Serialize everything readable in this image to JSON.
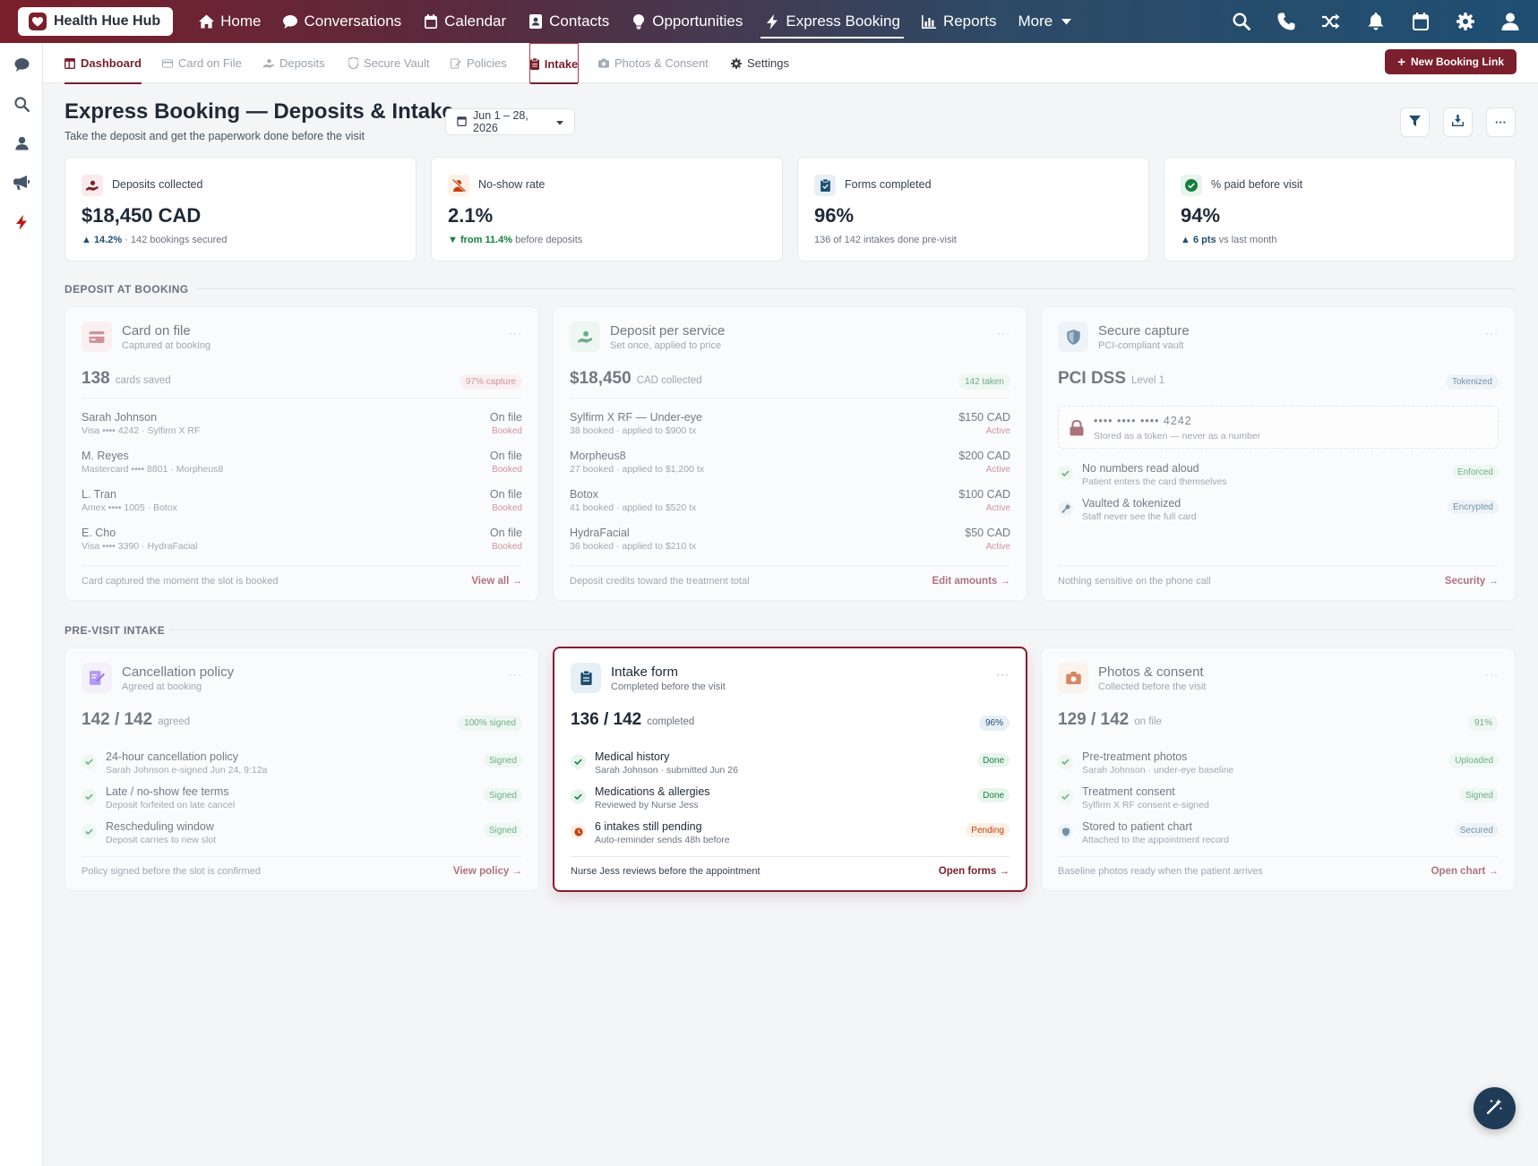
{
  "brand": {
    "name": "Health Hue Hub"
  },
  "nav": {
    "items": [
      {
        "label": "Home",
        "icon": "home-icon"
      },
      {
        "label": "Conversations",
        "icon": "chat-icon"
      },
      {
        "label": "Calendar",
        "icon": "calendar-icon"
      },
      {
        "label": "Contacts",
        "icon": "contact-card-icon"
      },
      {
        "label": "Opportunities",
        "icon": "lightbulb-icon"
      },
      {
        "label": "Express Booking",
        "icon": "bolt-icon",
        "active": true
      },
      {
        "label": "Reports",
        "icon": "bar-chart-icon"
      },
      {
        "label": "More",
        "icon": "caret-down-icon"
      }
    ],
    "right_icons": [
      "search-icon",
      "phone-icon",
      "shuffle-icon",
      "bell-icon",
      "calendar-icon",
      "gear-icon",
      "user-icon"
    ]
  },
  "rail_icons": [
    "chat-icon",
    "search-icon",
    "user-icon",
    "megaphone-icon",
    "bolt-icon"
  ],
  "subnav": {
    "tabs": [
      {
        "label": "Dashboard",
        "icon": "dashboard-icon",
        "active": true
      },
      {
        "label": "Card on File",
        "icon": "card-icon"
      },
      {
        "label": "Deposits",
        "icon": "hand-coin-icon"
      },
      {
        "label": "Secure Vault",
        "icon": "shield-icon"
      },
      {
        "label": "Policies",
        "icon": "sign-icon"
      },
      {
        "label": "Intake",
        "icon": "clipboard-icon"
      },
      {
        "label": "Photos & Consent",
        "icon": "camera-icon"
      },
      {
        "label": "Settings",
        "icon": "gear-icon"
      }
    ],
    "new_button": "New Booking Link"
  },
  "header": {
    "title": "Express Booking — Deposits & Intake",
    "subtitle": "Take the deposit and get the paperwork done before the visit",
    "date_range": "Jun 1 – 28, 2026"
  },
  "kpis": [
    {
      "label": "Deposits collected",
      "value": "$18,450 CAD",
      "delta": "▲ 14.2%",
      "note": " · 142 bookings secured",
      "color": "#7a1f2b"
    },
    {
      "label": "No-show rate",
      "value": "2.1%",
      "delta": "▼ from 11.4%",
      "note": " before deposits",
      "color": "#c2410c"
    },
    {
      "label": "Forms completed",
      "value": "96%",
      "delta": "",
      "note": "136 of 142 intakes done pre-visit",
      "color": "#1e4f73"
    },
    {
      "label": "% paid before visit",
      "value": "94%",
      "delta": "▲ 6 pts",
      "note": " vs last month",
      "color": "#15803d"
    }
  ],
  "sections": {
    "deposit": "DEPOSIT AT BOOKING",
    "intake": "PRE-VISIT INTAKE"
  },
  "card_on_file": {
    "title": "Card on file",
    "subtitle": "Captured at booking",
    "big": "138",
    "unit": "cards saved",
    "pill": "97% capture",
    "rows": [
      {
        "name": "Sarah Johnson",
        "sub": "Visa •••• 4242 · Sylfirm X RF",
        "value": "On file",
        "tag": "Booked"
      },
      {
        "name": "M. Reyes",
        "sub": "Mastercard •••• 8801 · Morpheus8",
        "value": "On file",
        "tag": "Booked"
      },
      {
        "name": "L. Tran",
        "sub": "Amex •••• 1005 · Botox",
        "value": "On file",
        "tag": "Booked"
      },
      {
        "name": "E. Cho",
        "sub": "Visa •••• 3390 · HydraFacial",
        "value": "On file",
        "tag": "Booked"
      }
    ],
    "footer": "Card captured the moment the slot is booked",
    "link": "View all →"
  },
  "deposit_per_service": {
    "title": "Deposit per service",
    "subtitle": "Set once, applied to price",
    "big": "$18,450",
    "unit": "CAD collected",
    "pill": "142 taken",
    "rows": [
      {
        "name": "Sylfirm X RF — Under-eye",
        "sub": "38 booked · applied to $900 tx",
        "value": "$150 CAD",
        "tag": "Active"
      },
      {
        "name": "Morpheus8",
        "sub": "27 booked · applied to $1,200 tx",
        "value": "$200 CAD",
        "tag": "Active"
      },
      {
        "name": "Botox",
        "sub": "41 booked · applied to $520 tx",
        "value": "$100 CAD",
        "tag": "Active"
      },
      {
        "name": "HydraFacial",
        "sub": "36 booked · applied to $210 tx",
        "value": "$50 CAD",
        "tag": "Active"
      }
    ],
    "footer": "Deposit credits toward the treatment total",
    "link": "Edit amounts →"
  },
  "secure_capture": {
    "title": "Secure capture",
    "subtitle": "PCI-compliant vault",
    "big": "PCI DSS",
    "unit": "Level 1",
    "pill": "Tokenized",
    "vault_number": "•••• •••• •••• 4242",
    "vault_note": "Stored as a token — never as a number",
    "items": [
      {
        "name": "No numbers read aloud",
        "sub": "Patient enters the card themselves",
        "badge": "Enforced"
      },
      {
        "name": "Vaulted & tokenized",
        "sub": "Staff never see the full card",
        "badge": "Encrypted"
      }
    ],
    "footer": "Nothing sensitive on the phone call",
    "link": "Security →"
  },
  "cancellation": {
    "title": "Cancellation policy",
    "subtitle": "Agreed at booking",
    "big": "142 / 142",
    "unit": "agreed",
    "pill": "100% signed",
    "items": [
      {
        "name": "24-hour cancellation policy",
        "sub": "Sarah Johnson e-signed Jun 24, 9:12a",
        "badge": "Signed"
      },
      {
        "name": "Late / no-show fee terms",
        "sub": "Deposit forfeited on late cancel",
        "badge": "Signed"
      },
      {
        "name": "Rescheduling window",
        "sub": "Deposit carries to new slot",
        "badge": "Signed"
      }
    ],
    "footer": "Policy signed before the slot is confirmed",
    "link": "View policy →"
  },
  "intake_form": {
    "title": "Intake form",
    "subtitle": "Completed before the visit",
    "big": "136 / 142",
    "unit": "completed",
    "pill": "96%",
    "items": [
      {
        "name": "Medical history",
        "sub": "Sarah Johnson · submitted Jun 26",
        "badge": "Done"
      },
      {
        "name": "Medications & allergies",
        "sub": "Reviewed by Nurse Jess",
        "badge": "Done"
      },
      {
        "name": "6 intakes still pending",
        "sub": "Auto-reminder sends 48h before",
        "badge": "Pending"
      }
    ],
    "footer": "Nurse Jess reviews before the appointment",
    "link": "Open forms →"
  },
  "photos_consent": {
    "title": "Photos & consent",
    "subtitle": "Collected before the visit",
    "big": "129 / 142",
    "unit": "on file",
    "pill": "91%",
    "items": [
      {
        "name": "Pre-treatment photos",
        "sub": "Sarah Johnson · under-eye baseline",
        "badge": "Uploaded"
      },
      {
        "name": "Treatment consent",
        "sub": "Sylfirm X RF consent e-signed",
        "badge": "Signed"
      },
      {
        "name": "Stored to patient chart",
        "sub": "Attached to the appointment record",
        "badge": "Secured"
      }
    ],
    "footer": "Baseline photos ready when the patient arrives",
    "link": "Open chart →"
  },
  "colors": {
    "brand": "#7a1f2b",
    "nav_end": "#1e4f73",
    "success": "#15803d",
    "pending": "#c2410c"
  }
}
